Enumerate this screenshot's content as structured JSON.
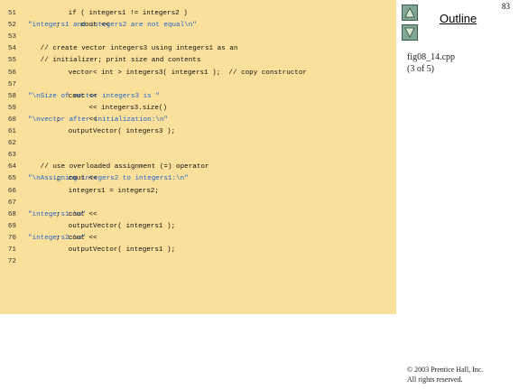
{
  "page_number": "83",
  "outline_label": "Outline",
  "file_name": "fig08_14.cpp",
  "page_position": "(3 of 5)",
  "copyright_line1": "© 2003 Prentice Hall, Inc.",
  "copyright_line2": "All rights reserved.",
  "code_lines": [
    {
      "num": "51",
      "segs": [
        {
          "t": "   if ( integers1 != integers2 )",
          "c": "code"
        }
      ]
    },
    {
      "num": "52",
      "segs": [
        {
          "t": "      cout << ",
          "c": "code"
        },
        {
          "t": "\"integers1 and integers2 are not equal\\n\"",
          "c": "str"
        },
        {
          "t": ";",
          "c": "code"
        }
      ]
    },
    {
      "num": "53",
      "segs": []
    },
    {
      "num": "54",
      "segs": [
        {
          "t": "   // create vector integers3 using integers1 as an",
          "c": "cmt"
        }
      ]
    },
    {
      "num": "55",
      "segs": [
        {
          "t": "   // initializer; print size and contents",
          "c": "cmt"
        }
      ]
    },
    {
      "num": "56",
      "segs": [
        {
          "t": "   vector< int > integers3( integers1 );  // copy constructor",
          "c": "code"
        }
      ]
    },
    {
      "num": "57",
      "segs": []
    },
    {
      "num": "58",
      "segs": [
        {
          "t": "   cout << ",
          "c": "code"
        },
        {
          "t": "\"\\nSize of vector integers3 is \"",
          "c": "str"
        }
      ]
    },
    {
      "num": "59",
      "segs": [
        {
          "t": "        << integers3.size()",
          "c": "code"
        }
      ]
    },
    {
      "num": "60",
      "segs": [
        {
          "t": "        << ",
          "c": "code"
        },
        {
          "t": "\"\\nvector after initialization:\\n\"",
          "c": "str"
        },
        {
          "t": ";",
          "c": "code"
        }
      ]
    },
    {
      "num": "61",
      "segs": [
        {
          "t": "   outputVector( integers3 );",
          "c": "code"
        }
      ]
    },
    {
      "num": "62",
      "segs": []
    },
    {
      "num": "63",
      "segs": []
    },
    {
      "num": "64",
      "segs": [
        {
          "t": "   // use overloaded assignment (=) operator",
          "c": "cmt"
        }
      ]
    },
    {
      "num": "65",
      "segs": [
        {
          "t": "   cout << ",
          "c": "code"
        },
        {
          "t": "\"\\nAssigning integers2 to integers1:\\n\"",
          "c": "str"
        },
        {
          "t": ";",
          "c": "code"
        }
      ]
    },
    {
      "num": "66",
      "segs": [
        {
          "t": "   integers1 = integers2;",
          "c": "code"
        }
      ]
    },
    {
      "num": "67",
      "segs": []
    },
    {
      "num": "68",
      "segs": [
        {
          "t": "   cout << ",
          "c": "code"
        },
        {
          "t": "\"integers1:\\n\"",
          "c": "str"
        },
        {
          "t": ";",
          "c": "code"
        }
      ]
    },
    {
      "num": "69",
      "segs": [
        {
          "t": "   outputVector( integers1 );",
          "c": "code"
        }
      ]
    },
    {
      "num": "70",
      "segs": [
        {
          "t": "   cout << ",
          "c": "code"
        },
        {
          "t": "\"integers2:\\n\"",
          "c": "str"
        },
        {
          "t": ";",
          "c": "code"
        }
      ]
    },
    {
      "num": "71",
      "segs": [
        {
          "t": "   outputVector( integers1 );",
          "c": "code"
        }
      ]
    },
    {
      "num": "72",
      "segs": []
    }
  ]
}
